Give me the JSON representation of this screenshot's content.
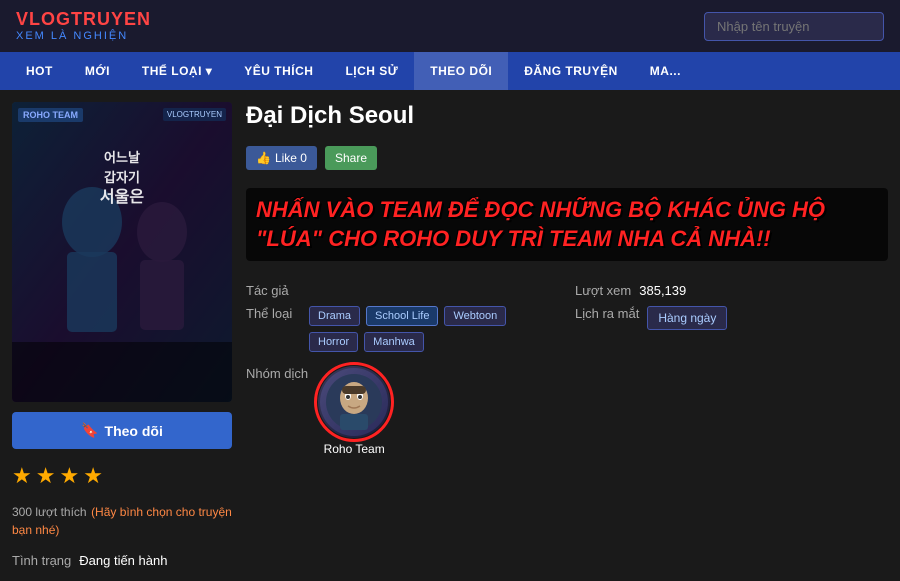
{
  "header": {
    "logo_top": "VLOGTRUYEN",
    "logo_bottom": "XEM LÀ NGHIỆN",
    "search_placeholder": "Nhập tên truyện"
  },
  "nav": {
    "items": [
      {
        "label": "HOT"
      },
      {
        "label": "MỚI"
      },
      {
        "label": "THỂ LOẠI ▾"
      },
      {
        "label": "YÊU THÍCH"
      },
      {
        "label": "LỊCH SỬ"
      },
      {
        "label": "THEO DÕI"
      },
      {
        "label": "ĐĂNG TRUYỆN"
      },
      {
        "label": "MA..."
      }
    ]
  },
  "manga": {
    "title": "Đại Dịch Seoul",
    "cover_korean": "어느날갑자기서울은",
    "cover_badge": "VLOGTRUYEN",
    "cover_badge2": "ROHO TEAM",
    "overlay_message": "NHẤN VÀO TEAM ĐỂ ĐỌC NHỮNG BỘ KHÁC ỦNG HỘ \"LÚA\" CHO ROHO DUY TRÌ TEAM NHA CẢ NHÀ!!",
    "like_label": "Like 0",
    "share_label": "Share",
    "author_label": "Tác giả",
    "author_value": "",
    "genre_label": "Thể loại",
    "genres": [
      "Drama",
      "School Life",
      "Webtoon",
      "Horror",
      "Manhwa"
    ],
    "group_label": "Nhóm dịch",
    "team_name": "Roho Team",
    "views_label": "Lượt xem",
    "views_value": "385,139",
    "schedule_label": "Lịch ra mắt",
    "schedule_value": "Hàng ngày",
    "follow_label": "Theo dõi",
    "stars": [
      "★",
      "★",
      "★",
      "★"
    ],
    "votes_count": "300 lượt thích",
    "votes_hint": "(Hãy bình chọn cho truyện bạn nhé)",
    "status_label": "Tình trạng",
    "status_value": "Đang tiến hành"
  }
}
